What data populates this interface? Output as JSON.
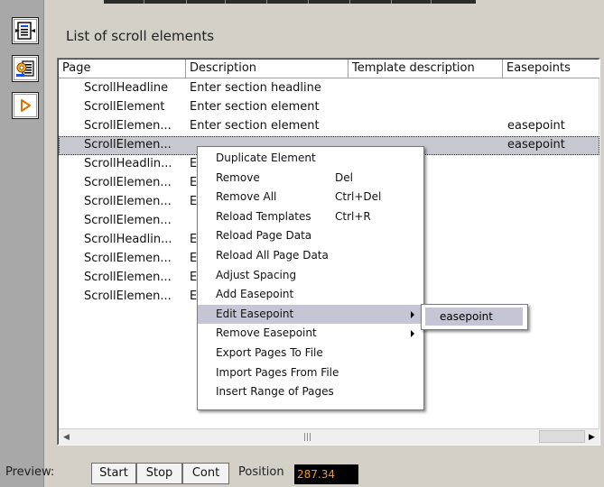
{
  "panel": {
    "title": "List of scroll elements"
  },
  "sidebar": [
    {
      "name": "page-layout-icon"
    },
    {
      "name": "settings-grid-icon"
    },
    {
      "name": "play-icon"
    }
  ],
  "columns": [
    "Page",
    "Description",
    "Template description",
    "Easepoints"
  ],
  "rows": [
    {
      "page": "ScrollHeadline",
      "description": "Enter section headline",
      "template": "",
      "easepoints": ""
    },
    {
      "page": "ScrollElement",
      "description": "Enter section element",
      "template": "",
      "easepoints": ""
    },
    {
      "page": "ScrollElemen...",
      "description": "Enter section element",
      "template": "",
      "easepoints": "easepoint"
    },
    {
      "page": "ScrollElemen...",
      "description": "",
      "template": "",
      "easepoints": "easepoint",
      "selected": true
    },
    {
      "page": "ScrollHeadlin...",
      "description": "E",
      "template": "",
      "easepoints": ""
    },
    {
      "page": "ScrollElemen...",
      "description": "E",
      "template": "",
      "easepoints": ""
    },
    {
      "page": "ScrollElemen...",
      "description": "E",
      "template": "",
      "easepoints": ""
    },
    {
      "page": "ScrollElemen...",
      "description": "",
      "template": "",
      "easepoints": ""
    },
    {
      "page": "ScrollHeadlin...",
      "description": "E",
      "template": "",
      "easepoints": ""
    },
    {
      "page": "ScrollElemen...",
      "description": "E",
      "template": "",
      "easepoints": ""
    },
    {
      "page": "ScrollElemen...",
      "description": "E",
      "template": "",
      "easepoints": ""
    },
    {
      "page": "ScrollElemen...",
      "description": "E",
      "template": "",
      "easepoints": ""
    }
  ],
  "context_menu": [
    {
      "label": "Duplicate Element",
      "shortcut": ""
    },
    {
      "label": "Remove",
      "shortcut": "Del"
    },
    {
      "label": "Remove All",
      "shortcut": "Ctrl+Del"
    },
    {
      "label": "Reload Templates",
      "shortcut": "Ctrl+R"
    },
    {
      "label": "Reload Page Data",
      "shortcut": ""
    },
    {
      "label": "Reload All Page Data",
      "shortcut": ""
    },
    {
      "label": "Adjust Spacing",
      "shortcut": ""
    },
    {
      "label": "Add Easepoint",
      "shortcut": ""
    },
    {
      "label": "Edit Easepoint",
      "shortcut": "",
      "submenu": true,
      "highlighted": true
    },
    {
      "label": "Remove Easepoint",
      "shortcut": "",
      "submenu": true
    },
    {
      "label": "Export Pages To File",
      "shortcut": ""
    },
    {
      "label": "Import Pages From File",
      "shortcut": ""
    },
    {
      "label": "Insert Range of Pages",
      "shortcut": ""
    }
  ],
  "submenu": {
    "item": "easepoint"
  },
  "preview": {
    "label": "Preview:",
    "buttons": [
      "Start",
      "Stop",
      "Cont"
    ],
    "position_label": "Position",
    "position_value": "287.34"
  },
  "colors": {
    "selection": "#c7c7cf",
    "menu_highlight": "#c6c5d5",
    "position_text": "#f09a2a"
  }
}
